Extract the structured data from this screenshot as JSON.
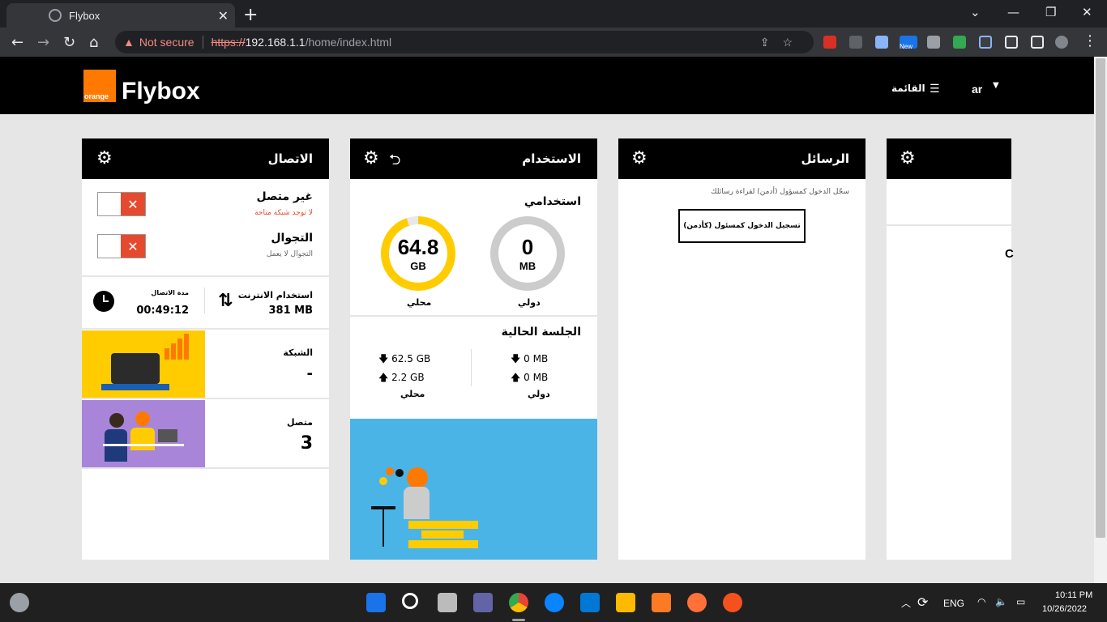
{
  "browser": {
    "tab_title": "Flybox",
    "security": "Not secure",
    "url_scheme": "https://",
    "url_host": "192.168.1.1",
    "url_path": "/home/index.html",
    "ext_new_badge": "New"
  },
  "header": {
    "logo_text": "orange",
    "brand": "Flybox",
    "menu_label": "القائمة",
    "lang": "ar"
  },
  "connection": {
    "title": "الاتصال",
    "status_title": "غير متصل",
    "status_sub": "لا توجد شبكة متاحة",
    "roaming_title": "التجوال",
    "roaming_sub": "التجوال لا يعمل",
    "duration_label": "مدة الاتصال",
    "duration_value": "00:49:12",
    "internet_label": "استخدام الانترنت",
    "internet_value": "381 MB",
    "network_label": "الشبكة",
    "network_value": "-",
    "connected_label": "متصل",
    "connected_value": "3"
  },
  "usage": {
    "title": "الاستخدام",
    "my_usage": "استخدامي",
    "intl_value": "0",
    "intl_unit": "MB",
    "intl_label": "دولي",
    "local_value": "64.8",
    "local_unit": "GB",
    "local_label": "محلي",
    "local_fill": 0.95,
    "session_title": "الجلسة الحالية",
    "intl_down": "0 MB",
    "intl_up": "0 MB",
    "local_down": "62.5 GB",
    "local_up": "2.2 GB",
    "session_intl": "دولي",
    "session_local": "محلي"
  },
  "messages": {
    "title": "الرسائل",
    "note": "سجّل الدخول كمسؤول (أدمن) لقراءة رسائلك",
    "login_btn": "تسجيل الدخول كمسئول (كأدمن)"
  },
  "fourth": {
    "partial_char": "C"
  },
  "taskbar": {
    "lang": "ENG",
    "time": "10:11 PM",
    "date": "10/26/2022"
  },
  "colors": {
    "orange": "#ff7900",
    "yellow": "#ffcc00",
    "purple": "#a885d8",
    "blue": "#4bb4e6",
    "red": "#e64a2e"
  }
}
